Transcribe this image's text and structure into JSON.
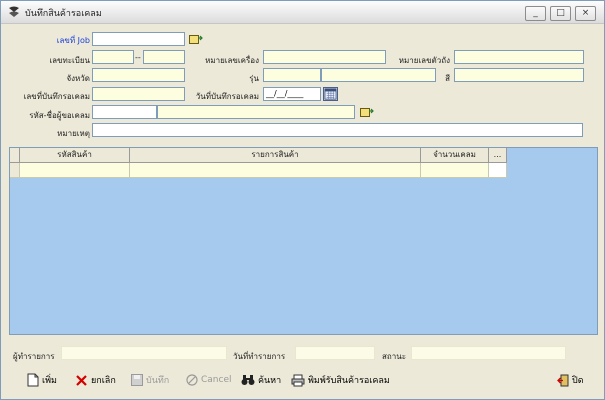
{
  "window": {
    "title": "บันทึกสินค้ารอเคลม",
    "controls": [
      "_",
      "□",
      "×"
    ]
  },
  "form": {
    "job_label": "เลขที่ Job",
    "reg_label": "เลขทะเบียน",
    "reg_sep": "--",
    "engine_label": "หมายเลขเครื่อง",
    "chassis_label": "หมายเลขตัวถัง",
    "province_label": "จังหวัด",
    "model_label": "รุ่น",
    "color_label": "สี",
    "claim_no_label": "เลขที่บันทึกรอเคลม",
    "claim_date_label": "วันที่บันทึกรอเคลม",
    "claim_date_value": "__/__/____",
    "claimant_label": "รหัส-ชื่อผู้ขอเคลม",
    "remark_label": "หมายเหตุ"
  },
  "grid": {
    "columns": [
      "รหัสสินค้า",
      "รายการสินค้า",
      "จำนวนเคลม",
      "..."
    ]
  },
  "footer": {
    "maker_label": "ผู้ทำรายการ",
    "date_label": "วันที่ทำรายการ",
    "status_label": "สถานะ"
  },
  "toolbar": {
    "add": "เพิ่ม",
    "cancel_th": "ยกเลิก",
    "save": "บันทึก",
    "cancel_en": "Cancel",
    "search": "ค้นหา",
    "print": "พิมพ์รับสินค้ารอเคลม",
    "close": "ปิด"
  },
  "colors": {
    "field_bg": "#fdfde0",
    "grid_bg": "#a6c9ee",
    "label_blue": "#1b3fd6"
  }
}
